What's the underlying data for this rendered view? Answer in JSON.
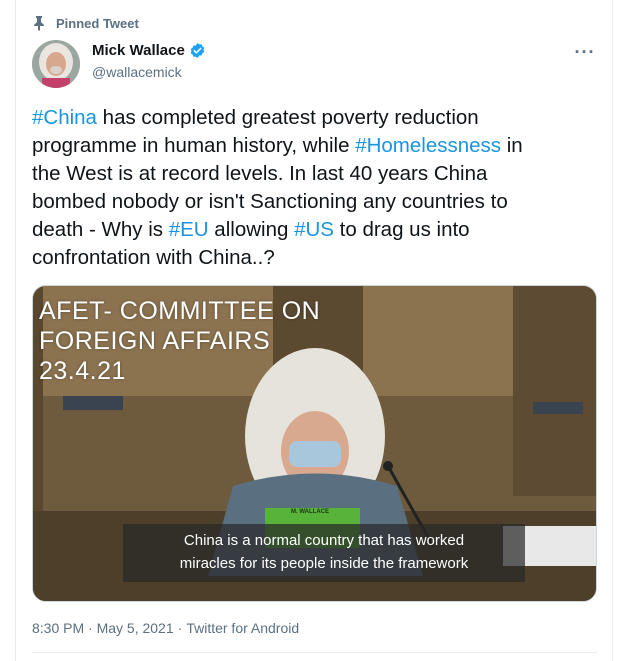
{
  "tweet": {
    "pinned_label": "Pinned Tweet",
    "author": {
      "name": "Mick Wallace",
      "handle": "@wallacemick",
      "verified": true
    },
    "more_label": "···",
    "text_lines": [
      [
        {
          "t": "#China",
          "tag": true
        },
        {
          "t": " has completed greatest poverty reduction",
          "tag": false
        }
      ],
      [
        {
          "t": "programme in human history, while ",
          "tag": false
        },
        {
          "t": "#Homelessness",
          "tag": true
        },
        {
          "t": " in",
          "tag": false
        }
      ],
      [
        {
          "t": "the West is at record levels.  In last 40 years China",
          "tag": false
        }
      ],
      [
        {
          "t": "bombed nobody or isn't Sanctioning any countries to",
          "tag": false
        }
      ],
      [
        {
          "t": "death - Why is ",
          "tag": false
        },
        {
          "t": "#EU",
          "tag": true
        },
        {
          "t": " allowing ",
          "tag": false
        },
        {
          "t": "#US",
          "tag": true
        },
        {
          "t": " to drag us into",
          "tag": false
        }
      ],
      [
        {
          "t": "confrontation with China..?",
          "tag": false
        }
      ]
    ],
    "video": {
      "overlay_lines": [
        "AFET- COMMITTEE ON",
        "FOREIGN AFFAIRS",
        "23.4.21"
      ],
      "nameplate": "M. WALLACE",
      "subtitle_lines": [
        "China is a normal country that has worked",
        "miracles for its people inside the framework"
      ]
    },
    "timestamp": "8:30 PM · May 5, 2021",
    "separator": "·",
    "source": "Twitter for Android"
  },
  "colors": {
    "accent": "#1b95e0",
    "secondary_text": "#5b7083",
    "verified": "#1da1f2"
  }
}
